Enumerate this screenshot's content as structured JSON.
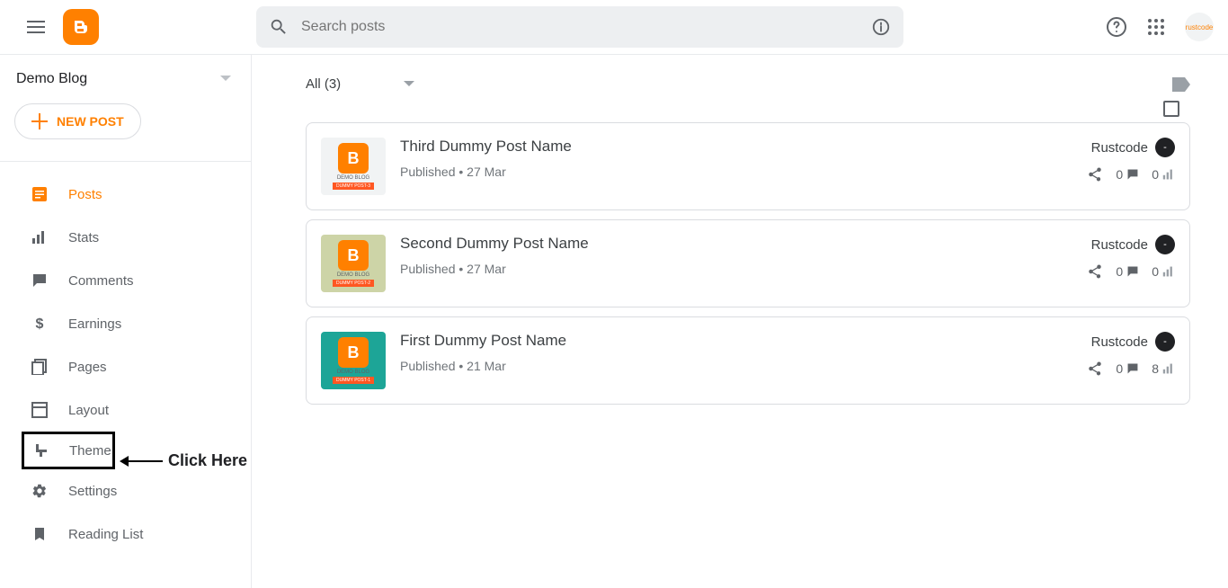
{
  "header": {
    "search_placeholder": "Search posts",
    "avatar_text": "rustcode"
  },
  "sidebar": {
    "blog_name": "Demo Blog",
    "new_post_label": "NEW POST",
    "nav": {
      "posts": "Posts",
      "stats": "Stats",
      "comments": "Comments",
      "earnings": "Earnings",
      "pages": "Pages",
      "layout": "Layout",
      "theme": "Theme",
      "settings": "Settings",
      "reading_list": "Reading List"
    }
  },
  "annotation": {
    "text": "Click Here"
  },
  "main": {
    "filter_label": "All (3)"
  },
  "posts": [
    {
      "title": "Third Dummy Post Name",
      "status": "Published",
      "date": "27 Mar",
      "author": "Rustcode",
      "comments": "0",
      "views": "0",
      "thumb_class": "thumb-a",
      "thumb_line1": "DEMO BLOG",
      "thumb_line2": "DUMMY POST-3"
    },
    {
      "title": "Second Dummy Post Name",
      "status": "Published",
      "date": "27 Mar",
      "author": "Rustcode",
      "comments": "0",
      "views": "0",
      "thumb_class": "thumb-b",
      "thumb_line1": "DEMO BLOG",
      "thumb_line2": "DUMMY POST-2"
    },
    {
      "title": "First Dummy Post Name",
      "status": "Published",
      "date": "21 Mar",
      "author": "Rustcode",
      "comments": "0",
      "views": "8",
      "thumb_class": "thumb-c",
      "thumb_line1": "DEMO BLOG",
      "thumb_line2": "DUMMY POST-1"
    }
  ]
}
